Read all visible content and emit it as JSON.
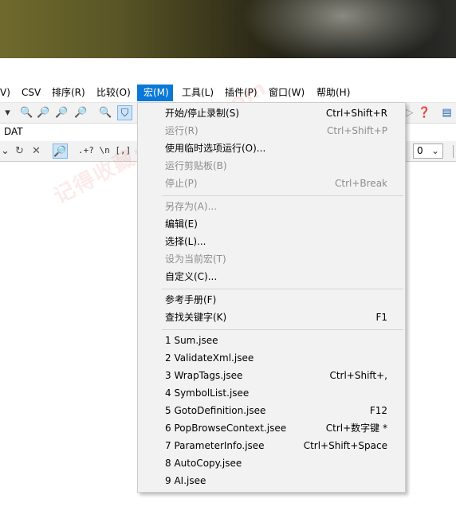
{
  "menubar": {
    "items": [
      {
        "label": "V)"
      },
      {
        "label": "CSV"
      },
      {
        "label": "排序(R)"
      },
      {
        "label": "比较(O)"
      },
      {
        "label": "宏(M)"
      },
      {
        "label": "工具(L)"
      },
      {
        "label": "插件(P)"
      },
      {
        "label": "窗口(W)"
      },
      {
        "label": "帮助(H)"
      }
    ]
  },
  "document": {
    "tab_label": "DAT"
  },
  "findbar": {
    "regex_tokens": ".+? \\n [,]",
    "count_value": "0"
  },
  "macro_menu": {
    "record": {
      "label": "开始/停止录制(S)",
      "shortcut": "Ctrl+Shift+R"
    },
    "run": {
      "label": "运行(R)",
      "shortcut": "Ctrl+Shift+P"
    },
    "run_temp": {
      "label": "使用临时选项运行(O)..."
    },
    "run_clipboard": {
      "label": "运行剪贴板(B)"
    },
    "stop": {
      "label": "停止(P)",
      "shortcut": "Ctrl+Break"
    },
    "save_as": {
      "label": "另存为(A)..."
    },
    "edit": {
      "label": "编辑(E)"
    },
    "select": {
      "label": "选择(L)..."
    },
    "set_current": {
      "label": "设为当前宏(T)"
    },
    "customize": {
      "label": "自定义(C)..."
    },
    "reference": {
      "label": "参考手册(F)"
    },
    "find_keyword": {
      "label": "查找关键字(K)",
      "shortcut": "F1"
    },
    "recent": [
      {
        "label": "1 Sum.jsee",
        "shortcut": ""
      },
      {
        "label": "2 ValidateXml.jsee",
        "shortcut": ""
      },
      {
        "label": "3 WrapTags.jsee",
        "shortcut": "Ctrl+Shift+,"
      },
      {
        "label": "4 SymbolList.jsee",
        "shortcut": ""
      },
      {
        "label": "5 GotoDefinition.jsee",
        "shortcut": "F12"
      },
      {
        "label": "6 PopBrowseContext.jsee",
        "shortcut": "Ctrl+数字键 *"
      },
      {
        "label": "7 ParameterInfo.jsee",
        "shortcut": "Ctrl+Shift+Space"
      },
      {
        "label": "8 AutoCopy.jsee",
        "shortcut": ""
      },
      {
        "label": "9 AI.jsee",
        "shortcut": ""
      }
    ]
  },
  "watermark": {
    "text": "记得收藏:ybase.com"
  }
}
